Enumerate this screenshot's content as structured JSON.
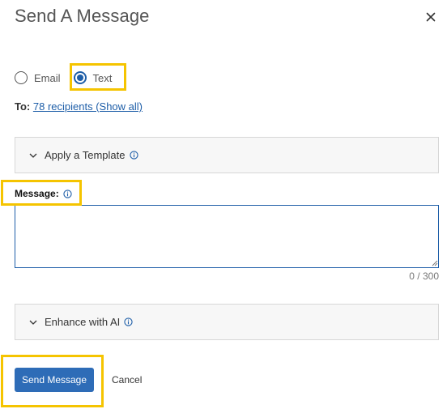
{
  "dialog": {
    "title": "Send A Message",
    "close_icon": "close-icon"
  },
  "channel": {
    "options": [
      {
        "label": "Email",
        "checked": false
      },
      {
        "label": "Text",
        "checked": true
      }
    ]
  },
  "recipients": {
    "to_label": "To:",
    "link_text": "78 recipients (Show all)"
  },
  "template_panel": {
    "label": "Apply a Template",
    "expand_icon": "chevron-down-icon",
    "info_icon": "info-icon"
  },
  "message": {
    "label": "Message:",
    "value": "",
    "counter": "0 / 300"
  },
  "ai_panel": {
    "label": "Enhance with AI",
    "expand_icon": "chevron-down-icon",
    "info_icon": "info-icon"
  },
  "actions": {
    "send_label": "Send Message",
    "cancel_label": "Cancel"
  },
  "colors": {
    "accent": "#2e6cb7",
    "link": "#1e5ea8",
    "highlight": "#f5c400"
  }
}
